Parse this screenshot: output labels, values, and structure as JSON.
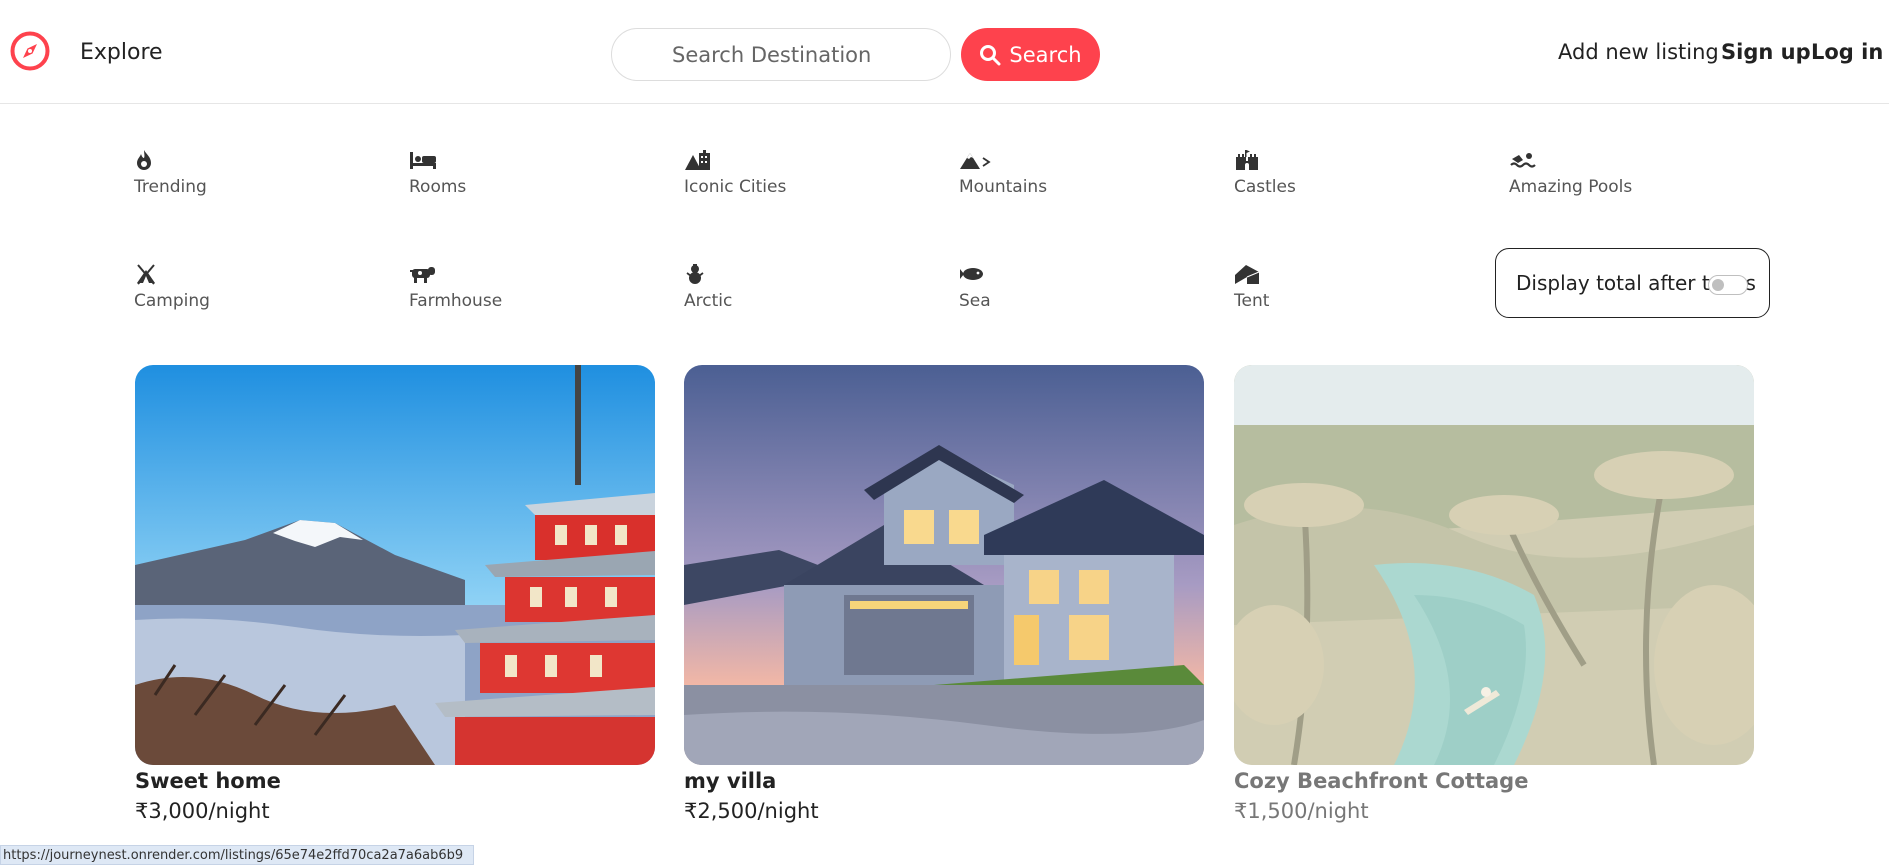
{
  "navbar": {
    "explore_label": "Explore",
    "search_placeholder": "Search Destination",
    "search_button": "Search",
    "add_listing": "Add new listing",
    "sign_up": "Sign up",
    "log_in": "Log in",
    "brand_color": "#fe424d"
  },
  "filters": [
    {
      "label": "Trending",
      "icon": "fire-icon"
    },
    {
      "label": "Rooms",
      "icon": "bed-icon"
    },
    {
      "label": "Iconic Cities",
      "icon": "city-icon"
    },
    {
      "label": "Mountains",
      "icon": "mountain-icon"
    },
    {
      "label": "Castles",
      "icon": "castle-icon"
    },
    {
      "label": "Amazing Pools",
      "icon": "swimmer-icon"
    },
    {
      "label": "Camping",
      "icon": "campground-icon"
    },
    {
      "label": "Farmhouse",
      "icon": "cow-icon"
    },
    {
      "label": "Arctic",
      "icon": "snowman-icon"
    },
    {
      "label": "Sea",
      "icon": "fish-icon"
    },
    {
      "label": "Tent",
      "icon": "tent-icon"
    }
  ],
  "tax_toggle": {
    "label": "Display total after taxes",
    "enabled": false
  },
  "listings": [
    {
      "title": "Sweet home",
      "price": "₹3,000/night"
    },
    {
      "title": "my villa",
      "price": "₹2,500/night"
    },
    {
      "title": "Cozy Beachfront Cottage",
      "price": "₹1,500/night"
    }
  ],
  "status_bar": {
    "url": "https://journeynest.onrender.com/listings/65e74e2ffd70ca2a7a6ab6b9"
  }
}
